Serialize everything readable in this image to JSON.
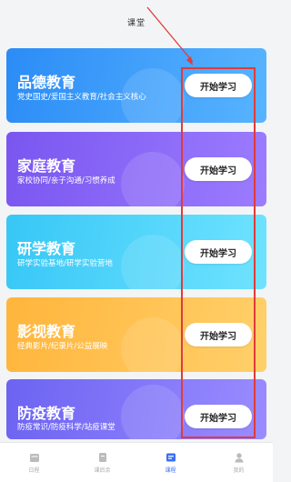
{
  "header": {
    "title": "课堂"
  },
  "cards": [
    {
      "title": "品德教育",
      "subtitle": "党史国史/爱国主义教育/社会主义核心",
      "button": "开始学习"
    },
    {
      "title": "家庭教育",
      "subtitle": "家校协同/亲子沟通/习惯养成",
      "button": "开始学习"
    },
    {
      "title": "研学教育",
      "subtitle": "研学实验基地/研学实验营地",
      "button": "开始学习"
    },
    {
      "title": "影视教育",
      "subtitle": "经典影片/纪录片/公益展映",
      "button": "开始学习"
    },
    {
      "title": "防疫教育",
      "subtitle": "防疫常识/防疫科学/站疫课堂",
      "button": "开始学习"
    }
  ],
  "tabbar": {
    "items": [
      {
        "label": "日程",
        "icon": "calendar-icon"
      },
      {
        "label": "课后余",
        "icon": "document-icon"
      },
      {
        "label": "课程",
        "icon": "course-icon"
      },
      {
        "label": "我的",
        "icon": "person-icon"
      }
    ],
    "active_index": 2
  },
  "colors": {
    "accent": "#3a6ff7",
    "annotation": "#e13b3b",
    "card1": "#2b8cf6",
    "card2": "#7a56f0",
    "card3": "#37c7f6",
    "card4": "#ffb53c",
    "card5": "#6c63f2"
  }
}
